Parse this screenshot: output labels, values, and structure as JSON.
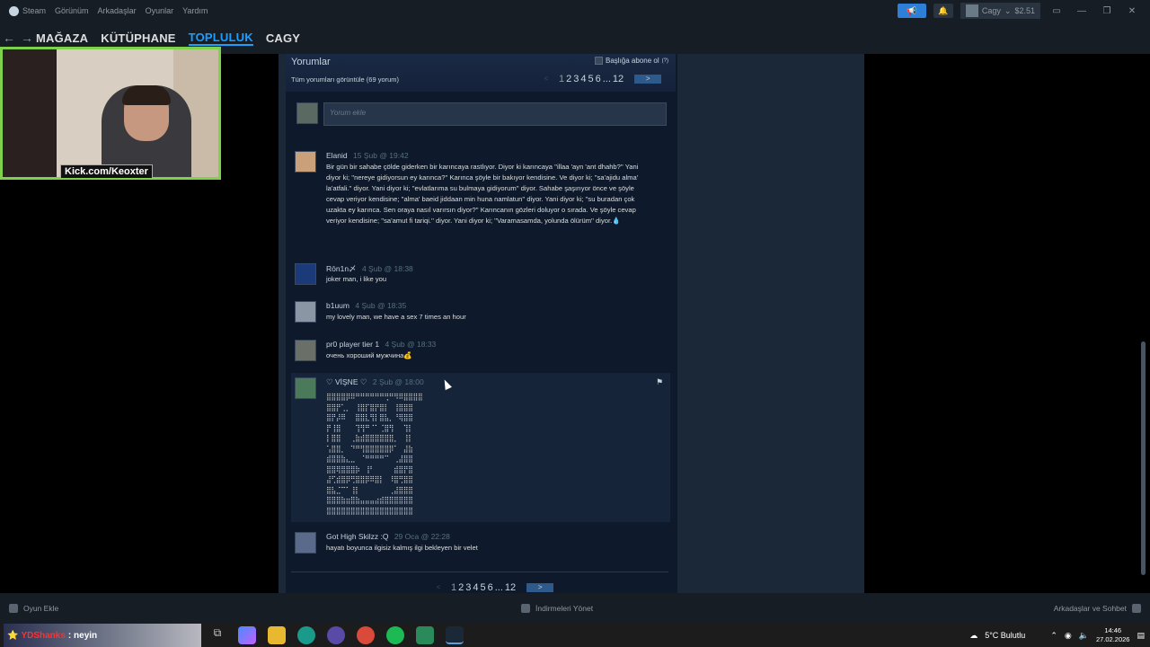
{
  "menu": {
    "items": [
      "Steam",
      "Görünüm",
      "Arkadaşlar",
      "Oyunlar",
      "Yardım"
    ]
  },
  "user": {
    "name": "Cagy",
    "balance": "$2.51"
  },
  "nav": {
    "tabs": [
      "MAĞAZA",
      "KÜTÜPHANE",
      "TOPLULUK",
      "CAGY"
    ],
    "active": "TOPLULUK"
  },
  "comments_panel": {
    "title": "Yorumlar",
    "view_all": "Tüm yorumları görüntüle (69 yorum)",
    "subscribe": "Başlığa abone ol",
    "pager": {
      "current": "1",
      "pages": [
        "2",
        "3",
        "4",
        "5",
        "6"
      ],
      "ellipsis": "...",
      "last": "12",
      "next": ">"
    },
    "add_placeholder": "Yorum ekle"
  },
  "comments": [
    {
      "author": "Elanid",
      "time": "15 Şub @ 19:42",
      "text": "Bir gün bir sahabe çölde giderken bir karıncaya rastlıyor. Diyor ki karıncaya ''illaa 'ayn 'ant dhahb?'' Yani diyor ki; ''nereye gidiyorsun ey karınca?'' Karınca şöyle bir bakıyor kendisine. Ve diyor ki; ''sa'ajidu alma' la'atfali.'' diyor. Yani diyor ki; ''evlatlarıma su bulmaya gidiyorum'' diyor. Sahabe şaşırıyor önce ve şöyle cevap veriyor kendisine; ''alma' baeid jiddaan min huna namlatun'' diyor. Yani diyor ki; ''su buradan çok uzakta ey karınca. Sen oraya nasıl varırsın diyor?'' Karıncanın gözleri doluyor o sırada. Ve şöyle cevap veriyor kendisine; ''sa'amut fi tariqi.'' diyor. Yani diyor ki; ''Varamasamda, yolunda ölürüm'' diyor.💧"
    },
    {
      "author": "Rōn1n〆",
      "time": "4 Şub @ 18:38",
      "text": "joker man, i like you"
    },
    {
      "author": "b1uum",
      "time": "4 Şub @ 18:35",
      "text": "my lovely man, we have a sex 7 times an hour"
    },
    {
      "author": "pr0 player tier 1",
      "time": "4 Şub @ 18:33",
      "text": "очень хороший мужчина💰"
    },
    {
      "author": "♡ VİŞNE ♡",
      "time": "2 Şub @ 18:00",
      "ascii": "⣿⣿⣿⣿⡿⠿⠛⠛⠛⠛⠛⠛⢛⠛⠻⠿⣿⣿⣿⣿\n⣿⣿⡟⢁⡀⠀⢸⣿⡏⣿⡟⣿⡇⠀⢸⣿⣿⣿\n⣿⡟⡼⠿⠀⠀⣿⣿⣇⢻⡇⣿⣧⡀⠘⢿⣿⣿\n⡟⢸⣿⠀⠀⠀⢹⢻⠛⠈⠁⢈⣿⢻⠀⠀⢹⡇\n⡇⣿⣿⠀⠀⢀⣷⣾⣿⣿⣿⣿⣿⣿⡀⠀⢸⡇\n⢡⣿⣿⡀⠀⠙⠛⢻⣿⣿⣿⣿⣿⡿⠁⠀⣼⣷\n⣾⣿⣿⣷⣄⣀⠀⠈⠛⠛⠛⠛⠉⠀⢀⣼⣿⣿\n⣿⣿⢿⣿⣿⣿⡷⠀⢸⠃⠀⠀⠀⠀⣾⣿⡟⣿\n⣼⢋⣾⣿⡿⢛⣿⣿⡿⠿⣿⡇⠀⠸⣿⢛⣿⣿\n⣿⣧⣈⠉⠁⢸⡇⠀⠀⠀⠀⠀⠀⢀⣼⣿⣿⣿\n⣿⣿⣿⣷⣶⣿⣷⣤⣤⣤⣴⣾⣿⣿⣿⣿⣿⣿\n⣿⣿⣿⣿⣿⣿⣿⣿⣿⣿⣿⣿⣿⣿⣿⣿⣿⣿"
    },
    {
      "author": "Got High Skilzz :Q",
      "time": "29 Oca @ 22:28",
      "text": "hayatı boyunca ilgisiz kalmış ilgi bekleyen bir velet"
    }
  ],
  "overlay": {
    "label": "Kick.com/Keoxter"
  },
  "bottombar": {
    "add_game": "Oyun Ekle",
    "downloads": "İndirmeleri Yönet",
    "friends": "Arkadaşlar ve Sohbet"
  },
  "taskbar": {
    "stream_name": "YDShanks",
    "stream_msg": ": neyin",
    "weather": "5°C Bulutlu",
    "time": "14:46",
    "date": "27.02.2026"
  },
  "colors": {
    "accent": "#1a9fff",
    "panel": "#0e1a2b",
    "highlight": "#16243a",
    "webcam_border": "#7fd04a"
  }
}
